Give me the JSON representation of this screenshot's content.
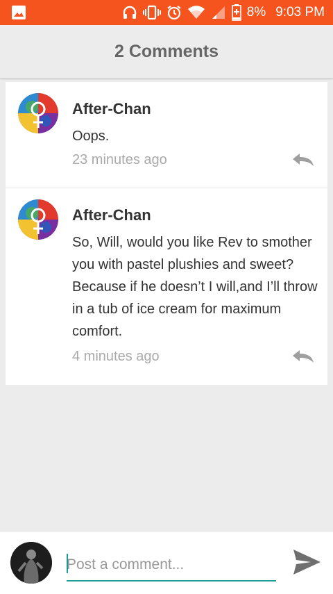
{
  "status_bar": {
    "battery": "8%",
    "time": "9:03 PM",
    "colors": {
      "background": "#f5541f"
    },
    "icons": [
      "image-icon",
      "headphones-icon",
      "vibrate-icon",
      "alarm-icon",
      "wifi-icon",
      "signal-icon",
      "battery-icon"
    ]
  },
  "header": {
    "title": "2 Comments"
  },
  "comments": [
    {
      "author": "After-Chan",
      "text": "Oops.",
      "time": "23 minutes ago"
    },
    {
      "author": "After-Chan",
      "text": "So, Will, would you like Rev to smother you with pastel plushies and sweet? Because if he doesn’t I will,and I’ll throw in a tub of ice cream for maximum comfort.",
      "time": "4 minutes ago"
    }
  ],
  "composer": {
    "placeholder": "Post a comment...",
    "value": ""
  },
  "colors": {
    "accent": "#1a9b93",
    "status_bar": "#f5541f"
  }
}
